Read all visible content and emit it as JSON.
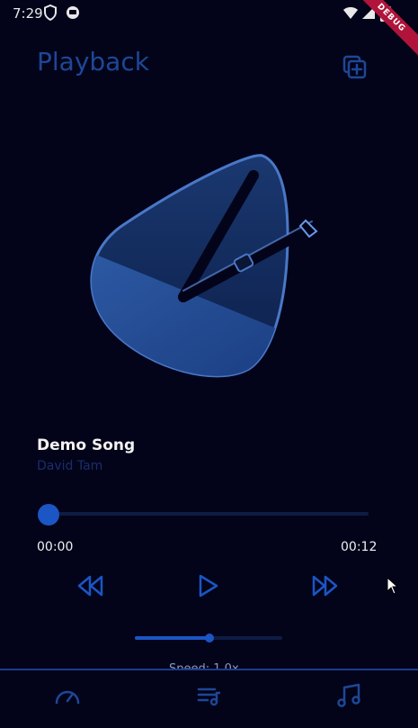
{
  "status_bar": {
    "time": "7:29",
    "debug_label": "DEBUG",
    "icons": [
      "shield-icon",
      "circle-app-icon",
      "wifi-icon",
      "signal-icon",
      "battery-icon"
    ]
  },
  "header": {
    "title": "Playback",
    "queue_icon": "add-to-queue-icon"
  },
  "track": {
    "title": "Demo Song",
    "artist": "David Tam",
    "artwork": "metronome-icon"
  },
  "progress": {
    "current": "00:00",
    "total": "00:12",
    "fraction": 0.0
  },
  "controls": {
    "previous": "rewind-icon",
    "play": "play-icon",
    "next": "fast-forward-icon"
  },
  "volume": {
    "fraction": 0.5
  },
  "speed": {
    "label": "Speed: 1.0x"
  },
  "bottom_nav": {
    "items": [
      "speedometer-icon",
      "playlist-icon",
      "music-note-icon"
    ]
  },
  "colors": {
    "background": "#03041a",
    "accent": "#1c55c4",
    "title": "#1e4796",
    "artist": "#1a2d6b"
  }
}
